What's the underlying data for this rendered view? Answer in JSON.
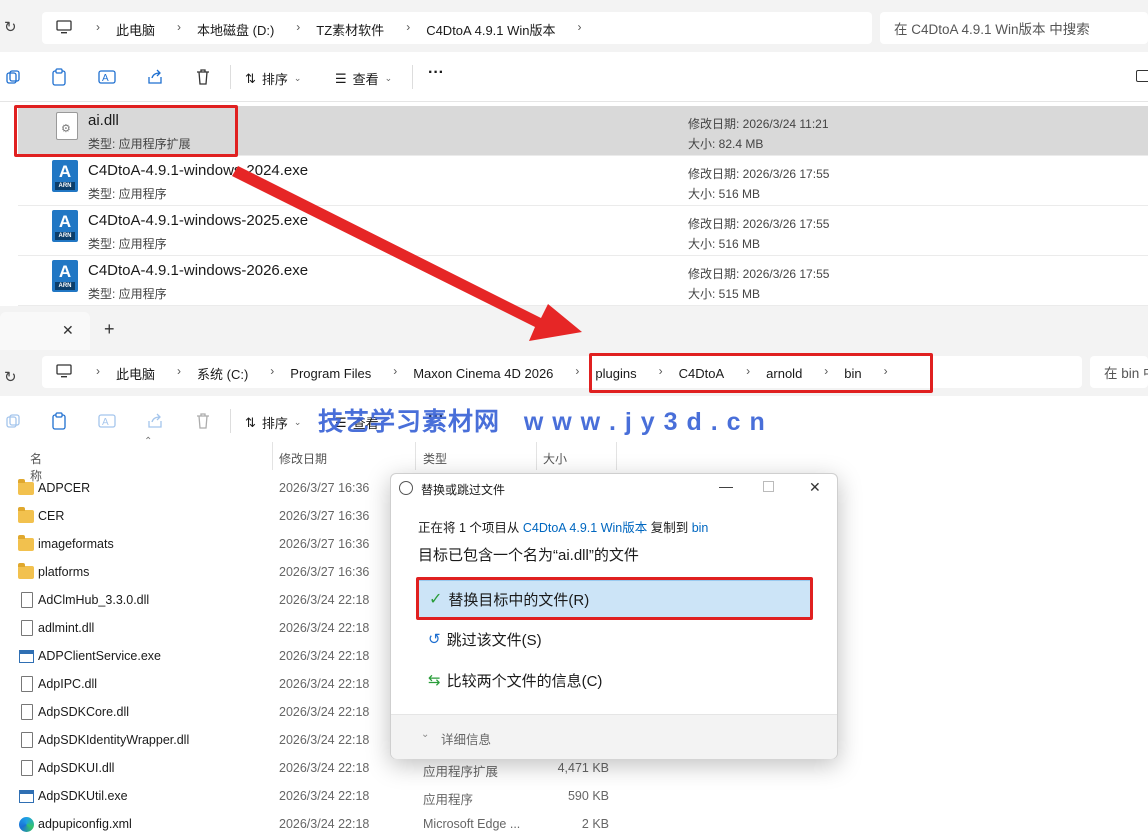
{
  "top_window": {
    "breadcrumb": [
      "此电脑",
      "本地磁盘 (D:)",
      "TZ素材软件",
      "C4DtoA 4.9.1 Win版本"
    ],
    "search_placeholder": "在 C4DtoA 4.9.1 Win版本 中搜索",
    "toolbar": {
      "sort_label": "排序",
      "view_label": "查看",
      "more": "···"
    },
    "files": [
      {
        "name": "ai.dll",
        "type": "类型: 应用程序扩展",
        "modified": "修改日期: 2026/3/24 11:21",
        "size": "大小: 82.4 MB",
        "icon": "dll-icon"
      },
      {
        "name": "C4DtoA-4.9.1-windows-2024.exe",
        "type": "类型: 应用程序",
        "modified": "修改日期: 2026/3/26 17:55",
        "size": "大小: 516 MB",
        "icon": "arnold-icon"
      },
      {
        "name": "C4DtoA-4.9.1-windows-2025.exe",
        "type": "类型: 应用程序",
        "modified": "修改日期: 2026/3/26 17:55",
        "size": "大小: 516 MB",
        "icon": "arnold-icon"
      },
      {
        "name": "C4DtoA-4.9.1-windows-2026.exe",
        "type": "类型: 应用程序",
        "modified": "修改日期: 2026/3/26 17:55",
        "size": "大小: 515 MB",
        "icon": "arnold-icon"
      }
    ],
    "arn_badge": "ARN",
    "arn_letter": "A"
  },
  "bottom_window": {
    "tab_close": "✕",
    "tab_add": "+",
    "breadcrumb": [
      "此电脑",
      "系统 (C:)",
      "Program Files",
      "Maxon Cinema 4D 2026",
      "plugins",
      "C4DtoA",
      "arnold",
      "bin"
    ],
    "search_placeholder": "在 bin 中搜索",
    "toolbar": {
      "sort_label": "排序",
      "view_label": "查看",
      "more": "···"
    },
    "watermark": "技艺学习素材网   w w w . j y 3 d . c n",
    "columns": {
      "name": "名称",
      "modified": "修改日期",
      "type": "类型",
      "size": "大小"
    },
    "rows": [
      {
        "name": "ADPCER",
        "modified": "2026/3/27 16:36",
        "type": "",
        "size": "",
        "kind": "folder"
      },
      {
        "name": "CER",
        "modified": "2026/3/27 16:36",
        "type": "",
        "size": "",
        "kind": "folder"
      },
      {
        "name": "imageformats",
        "modified": "2026/3/27 16:36",
        "type": "",
        "size": "",
        "kind": "folder"
      },
      {
        "name": "platforms",
        "modified": "2026/3/27 16:36",
        "type": "",
        "size": "",
        "kind": "folder"
      },
      {
        "name": "AdClmHub_3.3.0.dll",
        "modified": "2026/3/24 22:18",
        "type": "",
        "size": "",
        "kind": "file"
      },
      {
        "name": "adlmint.dll",
        "modified": "2026/3/24 22:18",
        "type": "",
        "size": "",
        "kind": "file"
      },
      {
        "name": "ADPClientService.exe",
        "modified": "2026/3/24 22:18",
        "type": "",
        "size": "",
        "kind": "exe"
      },
      {
        "name": "AdpIPC.dll",
        "modified": "2026/3/24 22:18",
        "type": "",
        "size": "",
        "kind": "file"
      },
      {
        "name": "AdpSDKCore.dll",
        "modified": "2026/3/24 22:18",
        "type": "",
        "size": "",
        "kind": "file"
      },
      {
        "name": "AdpSDKIdentityWrapper.dll",
        "modified": "2026/3/24 22:18",
        "type": "",
        "size": "",
        "kind": "file"
      },
      {
        "name": "AdpSDKUI.dll",
        "modified": "2026/3/24 22:18",
        "type": "应用程序扩展",
        "size": "4,471 KB",
        "kind": "file"
      },
      {
        "name": "AdpSDKUtil.exe",
        "modified": "2026/3/24 22:18",
        "type": "应用程序",
        "size": "590 KB",
        "kind": "exe"
      },
      {
        "name": "adpupiconfig.xml",
        "modified": "2026/3/24 22:18",
        "type": "Microsoft Edge ...",
        "size": "2 KB",
        "kind": "edge"
      }
    ]
  },
  "dialog": {
    "title": "替换或跳过文件",
    "info_prefix": "正在将 1 个项目从 ",
    "info_source": "C4DtoA 4.9.1 Win版本",
    "info_mid": " 复制到 ",
    "info_dest": "bin",
    "heading": "目标已包含一个名为“ai.dll”的文件",
    "option_replace": "替换目标中的文件(R)",
    "option_skip": "跳过该文件(S)",
    "option_compare": "比较两个文件的信息(C)",
    "details": "详细信息"
  },
  "colors": {
    "highlight_red": "#e02020",
    "accent_blue": "#0067c0",
    "selected_option": "#cce4f7"
  }
}
